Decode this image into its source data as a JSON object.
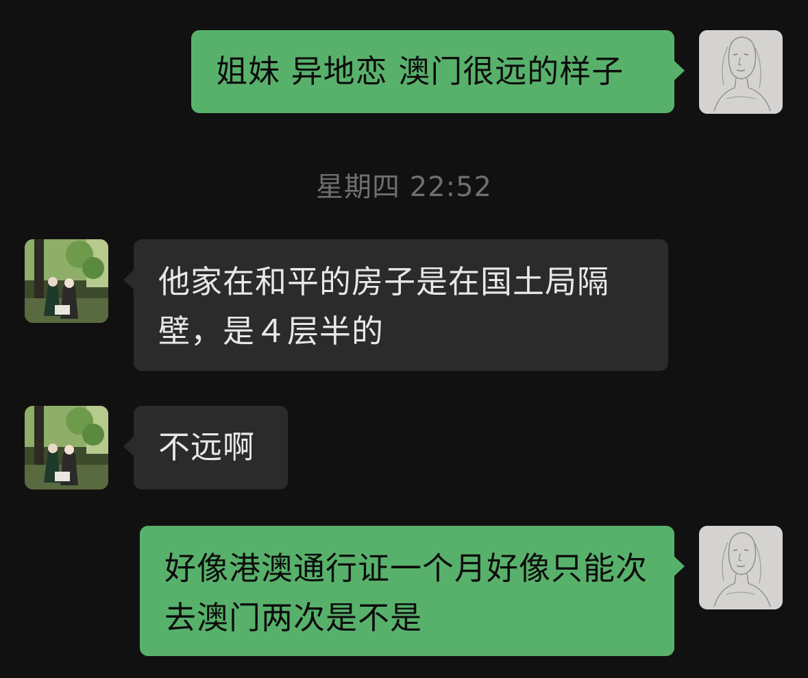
{
  "messages": [
    {
      "direction": "outgoing",
      "text": "姐妹 异地恋 澳门很远的样子"
    },
    {
      "direction": "incoming",
      "text": "他家在和平的房子是在国土局隔壁，是４层半的"
    },
    {
      "direction": "incoming",
      "text": "不远啊"
    },
    {
      "direction": "outgoing",
      "text": "好像港澳通行证一个月好像只能次去澳门两次是不是"
    }
  ],
  "timestamp": "星期四 22:52",
  "colors": {
    "background": "#111111",
    "outgoing_bubble": "#58b16b",
    "incoming_bubble": "#2b2b2b",
    "timestamp_text": "#6f6f6f"
  },
  "icons": {
    "self_avatar": "sketch-portrait-avatar",
    "contact_avatar": "garden-photo-avatar"
  }
}
